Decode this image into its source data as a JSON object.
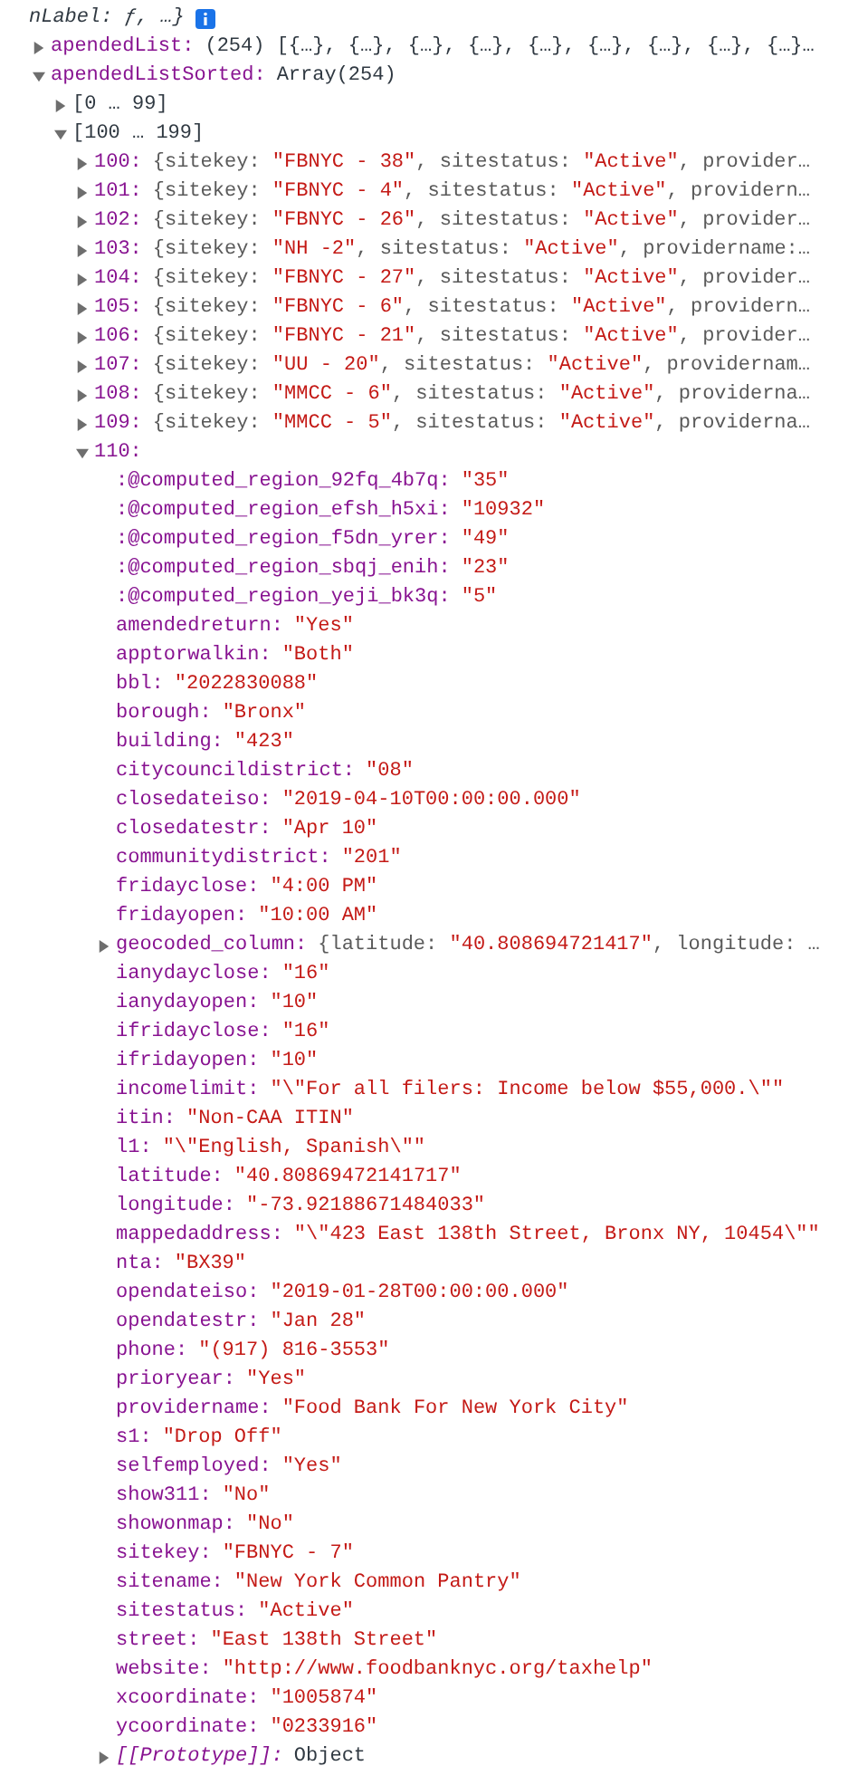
{
  "header": {
    "text": "nLabel: ƒ, …}"
  },
  "tree": [
    {
      "key": "apendedList:",
      "kind": "array",
      "value": "(254) [{…}, {…}, {…}, {…}, {…}, {…}, {…}, {…}, {…}…",
      "expanded": false
    },
    {
      "key": "apendedListSorted:",
      "kind": "array",
      "value": "Array(254)",
      "expanded": true,
      "children": [
        {
          "key": "[0 … 99]",
          "kind": "range",
          "expanded": false
        },
        {
          "key": "[100 … 199]",
          "kind": "range",
          "expanded": true,
          "children": [
            {
              "key": "100:",
              "kind": "preview",
              "expanded": false,
              "parts": [
                {
                  "kind": "plain",
                  "text": "{sitekey: "
                },
                {
                  "kind": "string",
                  "text": "\"FBNYC - 38\""
                },
                {
                  "kind": "plain",
                  "text": ", sitestatus: "
                },
                {
                  "kind": "string",
                  "text": "\"Active\""
                },
                {
                  "kind": "plain",
                  "text": ", provider…"
                }
              ]
            },
            {
              "key": "101:",
              "kind": "preview",
              "expanded": false,
              "parts": [
                {
                  "kind": "plain",
                  "text": "{sitekey: "
                },
                {
                  "kind": "string",
                  "text": "\"FBNYC - 4\""
                },
                {
                  "kind": "plain",
                  "text": ", sitestatus: "
                },
                {
                  "kind": "string",
                  "text": "\"Active\""
                },
                {
                  "kind": "plain",
                  "text": ", providern…"
                }
              ]
            },
            {
              "key": "102:",
              "kind": "preview",
              "expanded": false,
              "parts": [
                {
                  "kind": "plain",
                  "text": "{sitekey: "
                },
                {
                  "kind": "string",
                  "text": "\"FBNYC - 26\""
                },
                {
                  "kind": "plain",
                  "text": ", sitestatus: "
                },
                {
                  "kind": "string",
                  "text": "\"Active\""
                },
                {
                  "kind": "plain",
                  "text": ", provider…"
                }
              ]
            },
            {
              "key": "103:",
              "kind": "preview",
              "expanded": false,
              "parts": [
                {
                  "kind": "plain",
                  "text": "{sitekey: "
                },
                {
                  "kind": "string",
                  "text": "\"NH -2\""
                },
                {
                  "kind": "plain",
                  "text": ", sitestatus: "
                },
                {
                  "kind": "string",
                  "text": "\"Active\""
                },
                {
                  "kind": "plain",
                  "text": ", providername:…"
                }
              ]
            },
            {
              "key": "104:",
              "kind": "preview",
              "expanded": false,
              "parts": [
                {
                  "kind": "plain",
                  "text": "{sitekey: "
                },
                {
                  "kind": "string",
                  "text": "\"FBNYC - 27\""
                },
                {
                  "kind": "plain",
                  "text": ", sitestatus: "
                },
                {
                  "kind": "string",
                  "text": "\"Active\""
                },
                {
                  "kind": "plain",
                  "text": ", provider…"
                }
              ]
            },
            {
              "key": "105:",
              "kind": "preview",
              "expanded": false,
              "parts": [
                {
                  "kind": "plain",
                  "text": "{sitekey: "
                },
                {
                  "kind": "string",
                  "text": "\"FBNYC - 6\""
                },
                {
                  "kind": "plain",
                  "text": ", sitestatus: "
                },
                {
                  "kind": "string",
                  "text": "\"Active\""
                },
                {
                  "kind": "plain",
                  "text": ", providern…"
                }
              ]
            },
            {
              "key": "106:",
              "kind": "preview",
              "expanded": false,
              "parts": [
                {
                  "kind": "plain",
                  "text": "{sitekey: "
                },
                {
                  "kind": "string",
                  "text": "\"FBNYC - 21\""
                },
                {
                  "kind": "plain",
                  "text": ", sitestatus: "
                },
                {
                  "kind": "string",
                  "text": "\"Active\""
                },
                {
                  "kind": "plain",
                  "text": ", provider…"
                }
              ]
            },
            {
              "key": "107:",
              "kind": "preview",
              "expanded": false,
              "parts": [
                {
                  "kind": "plain",
                  "text": "{sitekey: "
                },
                {
                  "kind": "string",
                  "text": "\"UU - 20\""
                },
                {
                  "kind": "plain",
                  "text": ", sitestatus: "
                },
                {
                  "kind": "string",
                  "text": "\"Active\""
                },
                {
                  "kind": "plain",
                  "text": ", providernam…"
                }
              ]
            },
            {
              "key": "108:",
              "kind": "preview",
              "expanded": false,
              "parts": [
                {
                  "kind": "plain",
                  "text": "{sitekey: "
                },
                {
                  "kind": "string",
                  "text": "\"MMCC - 6\""
                },
                {
                  "kind": "plain",
                  "text": ", sitestatus: "
                },
                {
                  "kind": "string",
                  "text": "\"Active\""
                },
                {
                  "kind": "plain",
                  "text": ", providerna…"
                }
              ]
            },
            {
              "key": "109:",
              "kind": "preview",
              "expanded": false,
              "parts": [
                {
                  "kind": "plain",
                  "text": "{sitekey: "
                },
                {
                  "kind": "string",
                  "text": "\"MMCC - 5\""
                },
                {
                  "kind": "plain",
                  "text": ", sitestatus: "
                },
                {
                  "kind": "string",
                  "text": "\"Active\""
                },
                {
                  "kind": "plain",
                  "text": ", providerna…"
                }
              ]
            },
            {
              "key": "110:",
              "kind": "index",
              "expanded": true,
              "children": [
                {
                  "key": ":@computed_region_92fq_4b7q:",
                  "kind": "string",
                  "value": "\"35\""
                },
                {
                  "key": ":@computed_region_efsh_h5xi:",
                  "kind": "string",
                  "value": "\"10932\""
                },
                {
                  "key": ":@computed_region_f5dn_yrer:",
                  "kind": "string",
                  "value": "\"49\""
                },
                {
                  "key": ":@computed_region_sbqj_enih:",
                  "kind": "string",
                  "value": "\"23\""
                },
                {
                  "key": ":@computed_region_yeji_bk3q:",
                  "kind": "string",
                  "value": "\"5\""
                },
                {
                  "key": "amendedreturn:",
                  "kind": "string",
                  "value": "\"Yes\""
                },
                {
                  "key": "apptorwalkin:",
                  "kind": "string",
                  "value": "\"Both\""
                },
                {
                  "key": "bbl:",
                  "kind": "string",
                  "value": "\"2022830088\""
                },
                {
                  "key": "borough:",
                  "kind": "string",
                  "value": "\"Bronx\""
                },
                {
                  "key": "building:",
                  "kind": "string",
                  "value": "\"423\""
                },
                {
                  "key": "citycouncildistrict:",
                  "kind": "string",
                  "value": "\"08\""
                },
                {
                  "key": "closedateiso:",
                  "kind": "string",
                  "value": "\"2019-04-10T00:00:00.000\""
                },
                {
                  "key": "closedatestr:",
                  "kind": "string",
                  "value": "\"Apr 10\""
                },
                {
                  "key": "communitydistrict:",
                  "kind": "string",
                  "value": "\"201\""
                },
                {
                  "key": "fridayclose:",
                  "kind": "string",
                  "value": "\"4:00 PM\""
                },
                {
                  "key": "fridayopen:",
                  "kind": "string",
                  "value": "\"10:00 AM\""
                },
                {
                  "key": "geocoded_column:",
                  "kind": "preview",
                  "expanded": false,
                  "parts": [
                    {
                      "kind": "plain",
                      "text": "{latitude: "
                    },
                    {
                      "kind": "string",
                      "text": "\"40.808694721417\""
                    },
                    {
                      "kind": "plain",
                      "text": ", longitude: …"
                    }
                  ]
                },
                {
                  "key": "ianydayclose:",
                  "kind": "string",
                  "value": "\"16\""
                },
                {
                  "key": "ianydayopen:",
                  "kind": "string",
                  "value": "\"10\""
                },
                {
                  "key": "ifridayclose:",
                  "kind": "string",
                  "value": "\"16\""
                },
                {
                  "key": "ifridayopen:",
                  "kind": "string",
                  "value": "\"10\""
                },
                {
                  "key": "incomelimit:",
                  "kind": "string",
                  "value": "\"\\\"For all filers: Income below $55,000.\\\"\""
                },
                {
                  "key": "itin:",
                  "kind": "string",
                  "value": "\"Non-CAA ITIN\""
                },
                {
                  "key": "l1:",
                  "kind": "string",
                  "value": "\"\\\"English, Spanish\\\"\""
                },
                {
                  "key": "latitude:",
                  "kind": "string",
                  "value": "\"40.80869472141717\""
                },
                {
                  "key": "longitude:",
                  "kind": "string",
                  "value": "\"-73.92188671484033\""
                },
                {
                  "key": "mappedaddress:",
                  "kind": "string",
                  "value": "\"\\\"423 East 138th Street, Bronx NY, 10454\\\"\""
                },
                {
                  "key": "nta:",
                  "kind": "string",
                  "value": "\"BX39\""
                },
                {
                  "key": "opendateiso:",
                  "kind": "string",
                  "value": "\"2019-01-28T00:00:00.000\""
                },
                {
                  "key": "opendatestr:",
                  "kind": "string",
                  "value": "\"Jan 28\""
                },
                {
                  "key": "phone:",
                  "kind": "string",
                  "value": "\"(917) 816-3553\""
                },
                {
                  "key": "prioryear:",
                  "kind": "string",
                  "value": "\"Yes\""
                },
                {
                  "key": "providername:",
                  "kind": "string",
                  "value": "\"Food Bank For New York City\""
                },
                {
                  "key": "s1:",
                  "kind": "string",
                  "value": "\"Drop Off\""
                },
                {
                  "key": "selfemployed:",
                  "kind": "string",
                  "value": "\"Yes\""
                },
                {
                  "key": "show311:",
                  "kind": "string",
                  "value": "\"No\""
                },
                {
                  "key": "showonmap:",
                  "kind": "string",
                  "value": "\"No\""
                },
                {
                  "key": "sitekey:",
                  "kind": "string",
                  "value": "\"FBNYC - 7\""
                },
                {
                  "key": "sitename:",
                  "kind": "string",
                  "value": "\"New York Common Pantry\""
                },
                {
                  "key": "sitestatus:",
                  "kind": "string",
                  "value": "\"Active\""
                },
                {
                  "key": "street:",
                  "kind": "string",
                  "value": "\"East 138th Street\""
                },
                {
                  "key": "website:",
                  "kind": "string",
                  "value": "\"http://www.foodbanknyc.org/taxhelp\""
                },
                {
                  "key": "xcoordinate:",
                  "kind": "string",
                  "value": "\"1005874\""
                },
                {
                  "key": "ycoordinate:",
                  "kind": "string",
                  "value": "\"0233916\""
                },
                {
                  "key": "[[Prototype]]:",
                  "kind": "internal",
                  "value": "Object",
                  "expanded": false
                }
              ]
            }
          ]
        }
      ]
    }
  ]
}
